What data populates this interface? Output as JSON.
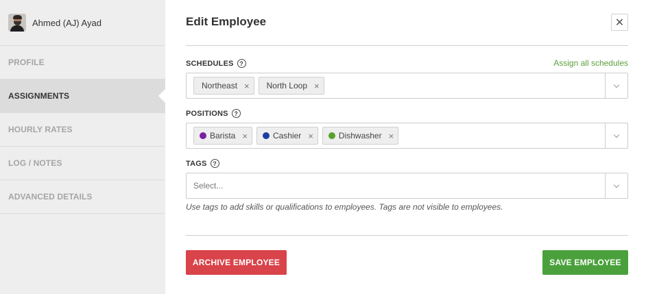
{
  "user": {
    "name": "Ahmed (AJ) Ayad"
  },
  "sidebar": {
    "items": [
      {
        "label": "PROFILE"
      },
      {
        "label": "ASSIGNMENTS"
      },
      {
        "label": "HOURLY RATES"
      },
      {
        "label": "LOG / NOTES"
      },
      {
        "label": "ADVANCED DETAILS"
      }
    ],
    "active": "ASSIGNMENTS"
  },
  "modal": {
    "title": "Edit Employee",
    "close_icon": "close-icon"
  },
  "schedules": {
    "label": "SCHEDULES",
    "assign_all": "Assign all schedules",
    "values": [
      {
        "label": "Northeast"
      },
      {
        "label": "North Loop"
      }
    ]
  },
  "positions": {
    "label": "POSITIONS",
    "values": [
      {
        "label": "Barista",
        "color": "#7a1fa2"
      },
      {
        "label": "Cashier",
        "color": "#1a3fa0"
      },
      {
        "label": "Dishwasher",
        "color": "#5aa02c"
      }
    ]
  },
  "tags": {
    "label": "TAGS",
    "placeholder": "Select...",
    "hint": "Use tags to add skills or qualifications to employees. Tags are not visible to employees."
  },
  "actions": {
    "archive_label": "ARCHIVE EMPLOYEE",
    "save_label": "SAVE EMPLOYEE"
  },
  "colors": {
    "archive": "#d9434a",
    "save": "#4aa13c",
    "link": "#5a9e3b"
  }
}
